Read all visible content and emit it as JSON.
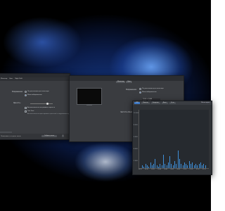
{
  "desktop": {
    "wallpaper_colors": [
      "#000000",
      "#0b1d4c",
      "#3f7fe0",
      "#e6f0ff"
    ]
  },
  "window_left": {
    "tabs": [
      "Монитор",
      "Цвет",
      "Night Shift"
    ],
    "labels": {
      "resolution": "Разрешение:",
      "opt_default": "По умолчанию для монитора",
      "opt_scaled": "Масштабированное",
      "brightness": "Яркость:",
      "auto_brightness": "Автоматически настраивать яркость",
      "true_tone": "True Tone",
      "true_tone_desc": "Автоматически адаптировать дисплей к окружающему освещению"
    },
    "brightness_level": 0.75,
    "bottom": {
      "airplay_label": "AirPlay",
      "status_left": "Показывать в строке меню",
      "collect_windows": "Собрать окна",
      "help_icon": "question-icon"
    }
  },
  "window_middle": {
    "segments": [
      "Монитор",
      "Цвет"
    ],
    "labels": {
      "resolution": "Разрешение:",
      "opt_default": "По умолчанию для монитора",
      "opt_scaled": "Масштабированное",
      "refresh": "Частота обновления:"
    },
    "resolutions": [
      "1920 × 1080",
      "1600 × 900",
      "1280 × 720"
    ],
    "selected_resolution_index": 1
  },
  "window_right": {
    "toolbar": [
      "CPU",
      "Память",
      "Энергия",
      "Диск",
      "Сеть"
    ],
    "active_index": 0,
    "right_label": "Мониторинг",
    "ylabels": [
      "10 000",
      "8 000",
      "6 000",
      "4 000",
      "2 000"
    ],
    "xticks": [
      "00:25",
      "00:30",
      "00:35",
      "00:40",
      "00:45",
      "00:50",
      "00:55",
      "01:00",
      "01:05",
      "01:10",
      "01:15"
    ],
    "bars": [
      2,
      1,
      3,
      2,
      1,
      4,
      2,
      3,
      6,
      2,
      1,
      3,
      2,
      9,
      3,
      2,
      4,
      8,
      3,
      2,
      5,
      3,
      12,
      6,
      3,
      2,
      4,
      3,
      2,
      5,
      3,
      4,
      2,
      3,
      2,
      3,
      4,
      2,
      3,
      2
    ],
    "accent": "#3f8fd8"
  }
}
